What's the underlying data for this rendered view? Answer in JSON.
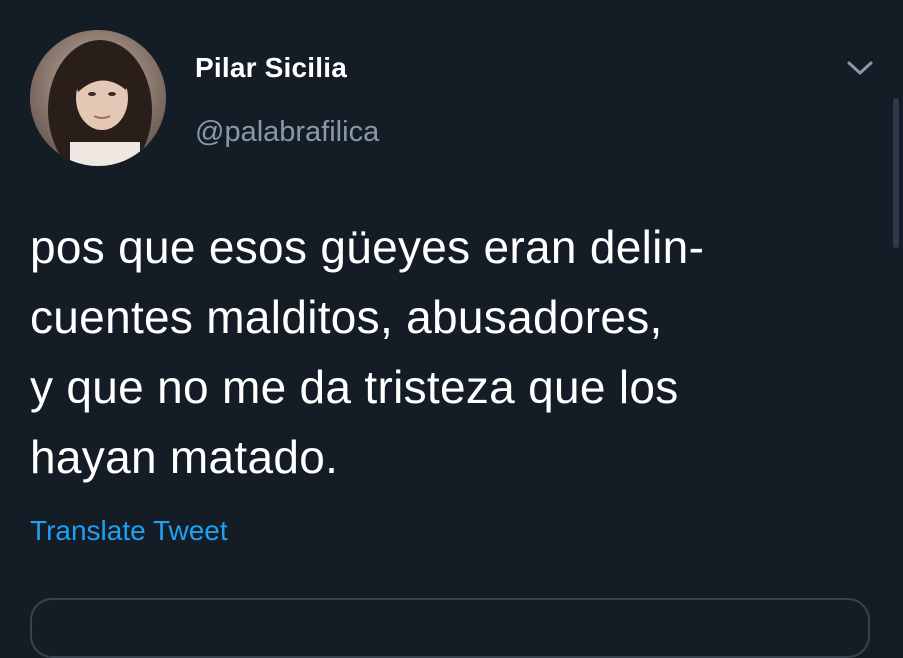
{
  "tweet": {
    "author_name": "Pilar Sicilia",
    "author_handle": "@palabrafilica",
    "text_lines": [
      "pos que esos güeyes eran delin-",
      "cuentes malditos, abusadores,",
      "y que no me da tristeza que los",
      "hayan matado."
    ],
    "translate_label": "Translate Tweet"
  },
  "icons": {
    "caret": "chevron-down-icon",
    "avatar": "avatar"
  },
  "colors": {
    "background": "#141d26",
    "text": "#ffffff",
    "muted": "#8899a6",
    "accent": "#1da1f2"
  }
}
